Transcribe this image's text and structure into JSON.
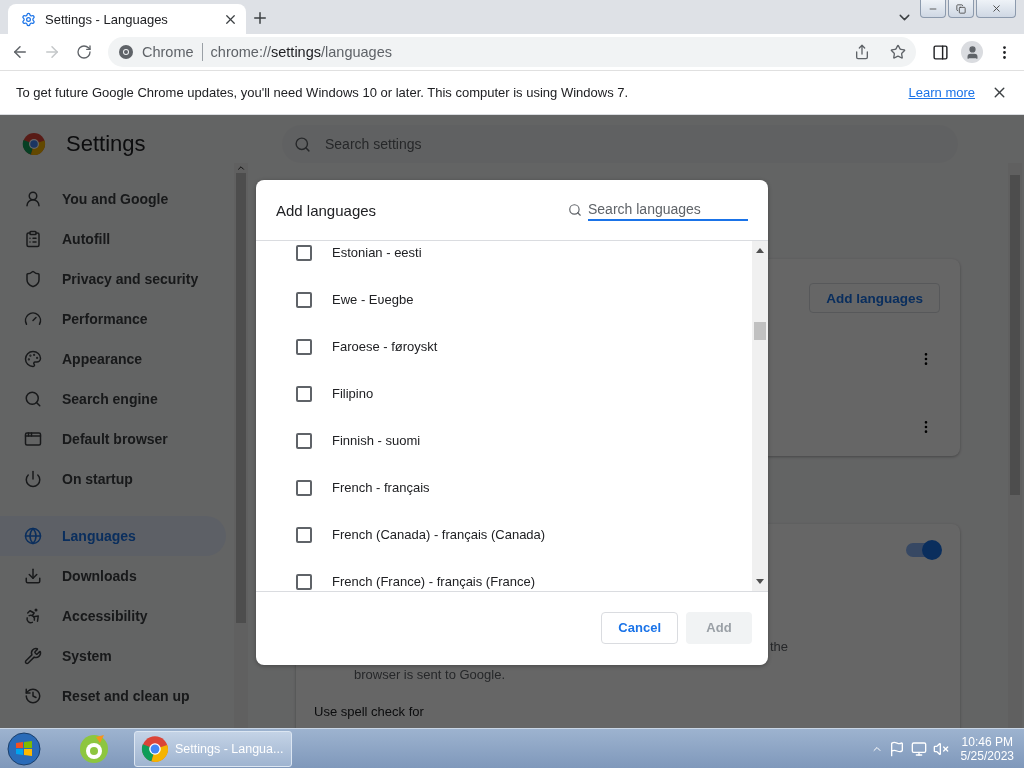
{
  "browser": {
    "tab": {
      "title": "Settings - Languages",
      "selected": true
    },
    "forward_disabled": true,
    "address": {
      "site_label": "Chrome",
      "url_prefix": "chrome://",
      "url_host": "settings",
      "url_path": "/languages"
    }
  },
  "infobar": {
    "message": "To get future Google Chrome updates, you'll need Windows 10 or later. This computer is using Windows 7.",
    "link": "Learn more"
  },
  "settings": {
    "title": "Settings",
    "search_placeholder": "Search settings",
    "sidebar": [
      {
        "label": "You and Google",
        "selected": false
      },
      {
        "label": "Autofill",
        "selected": false
      },
      {
        "label": "Privacy and security",
        "selected": false
      },
      {
        "label": "Performance",
        "selected": false
      },
      {
        "label": "Appearance",
        "selected": false
      },
      {
        "label": "Search engine",
        "selected": false
      },
      {
        "label": "Default browser",
        "selected": false
      },
      {
        "label": "On startup",
        "selected": false
      },
      {
        "label": "Languages",
        "selected": true
      },
      {
        "label": "Downloads",
        "selected": false
      },
      {
        "label": "Accessibility",
        "selected": false
      },
      {
        "label": "System",
        "selected": false
      },
      {
        "label": "Reset and clean up",
        "selected": false
      }
    ],
    "add_languages_button": "Add languages",
    "toggle_on": true,
    "line_end": "the",
    "line_second": "browser is sent to Google.",
    "spell_check_label": "Use spell check for"
  },
  "dialog": {
    "title": "Add languages",
    "search_placeholder": "Search languages",
    "languages": [
      {
        "label": "Estonian - eesti",
        "checked": false
      },
      {
        "label": "Ewe - Eʋegbe",
        "checked": false
      },
      {
        "label": "Faroese - føroyskt",
        "checked": false
      },
      {
        "label": "Filipino",
        "checked": false
      },
      {
        "label": "Finnish - suomi",
        "checked": false
      },
      {
        "label": "French - français",
        "checked": false
      },
      {
        "label": "French (Canada) - français (Canada)",
        "checked": false
      },
      {
        "label": "French (France) - français (France)",
        "checked": false
      }
    ],
    "cancel": "Cancel",
    "add": {
      "label": "Add",
      "disabled": true
    }
  },
  "taskbar": {
    "task": "Settings - Langua...",
    "time": "10:46 PM",
    "date": "5/25/2023"
  }
}
